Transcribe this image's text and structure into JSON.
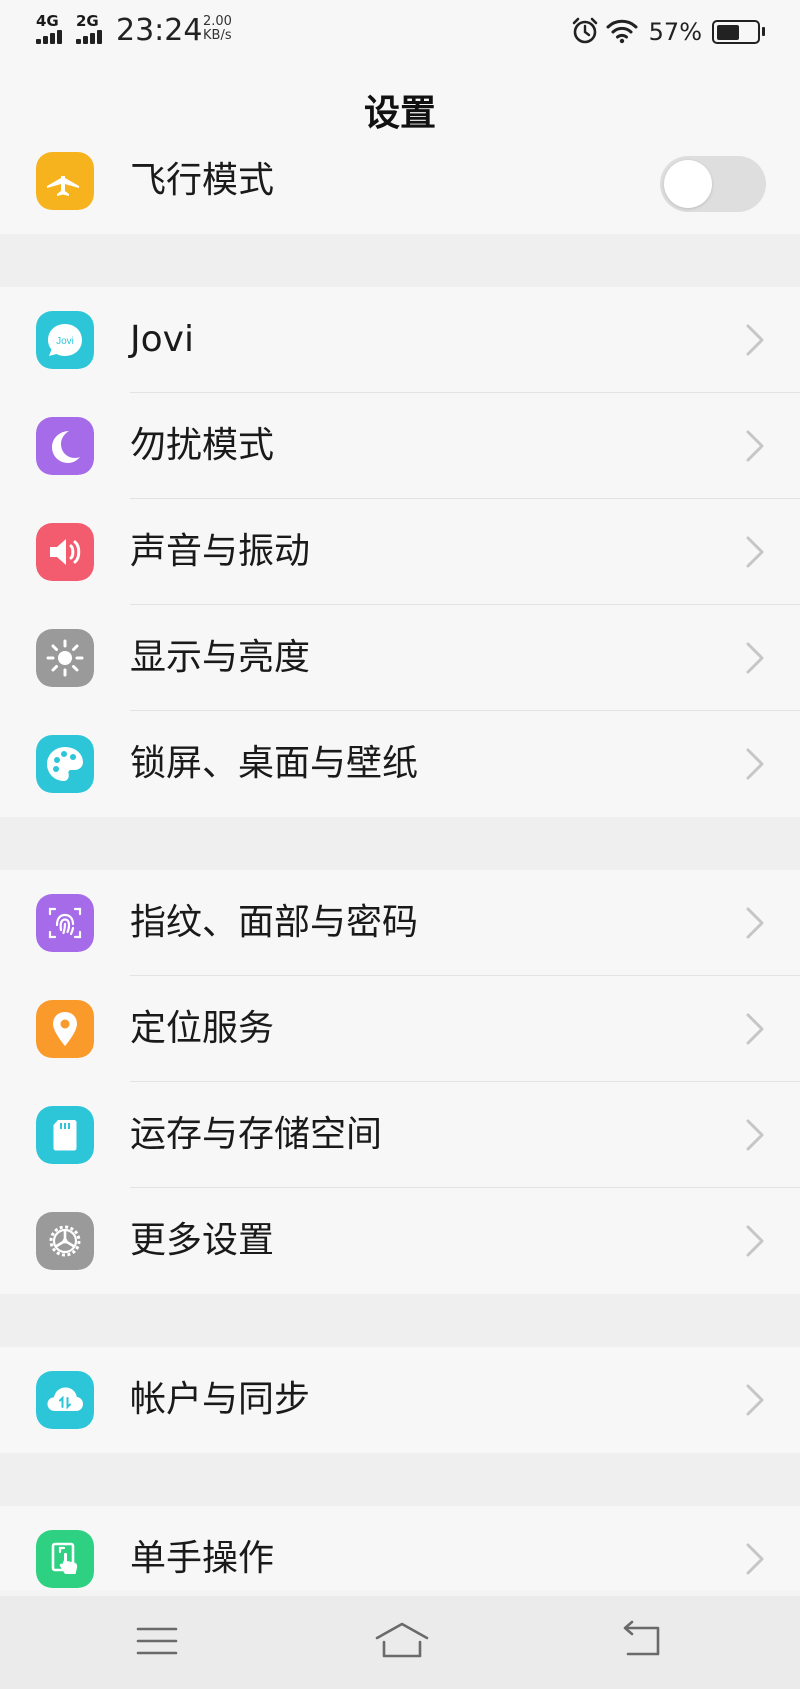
{
  "status_bar": {
    "sim1": "4G",
    "sim2": "2G",
    "time": "23:24",
    "net_speed_value": "2.00",
    "net_speed_unit": "KB/s",
    "battery_percent": "57%",
    "battery_level": 0.57
  },
  "header": {
    "title": "设置"
  },
  "groups": [
    {
      "items": [
        {
          "label": "飞行模式",
          "icon": "airplane-icon",
          "color": "#F7B31E",
          "toggle_on": false
        }
      ]
    },
    {
      "items": [
        {
          "label": "Jovi",
          "icon": "jovi-icon",
          "color": "#2DC6D9",
          "icon_text": "Jovi"
        },
        {
          "label": "勿扰模式",
          "icon": "moon-icon",
          "color": "#A66BE8"
        },
        {
          "label": "声音与振动",
          "icon": "speaker-icon",
          "color": "#F25C6E"
        },
        {
          "label": "显示与亮度",
          "icon": "sun-icon",
          "color": "#9A9A9A"
        },
        {
          "label": "锁屏、桌面与壁纸",
          "icon": "palette-icon",
          "color": "#2DC6D9"
        }
      ]
    },
    {
      "items": [
        {
          "label": "指纹、面部与密码",
          "icon": "fingerprint-icon",
          "color": "#A66BE8"
        },
        {
          "label": "定位服务",
          "icon": "location-pin-icon",
          "color": "#F99A2B"
        },
        {
          "label": "运存与存储空间",
          "icon": "sd-card-icon",
          "color": "#2DC6D9"
        },
        {
          "label": "更多设置",
          "icon": "gear-icon",
          "color": "#9A9A9A"
        }
      ]
    },
    {
      "items": [
        {
          "label": "帐户与同步",
          "icon": "cloud-sync-icon",
          "color": "#2DC6D9"
        }
      ]
    },
    {
      "items": [
        {
          "label": "单手操作",
          "icon": "one-hand-icon",
          "color": "#2ED182"
        }
      ]
    }
  ],
  "nav_bar": {
    "menu_icon": "menu-icon",
    "home_icon": "home-icon",
    "back_icon": "back-icon"
  }
}
